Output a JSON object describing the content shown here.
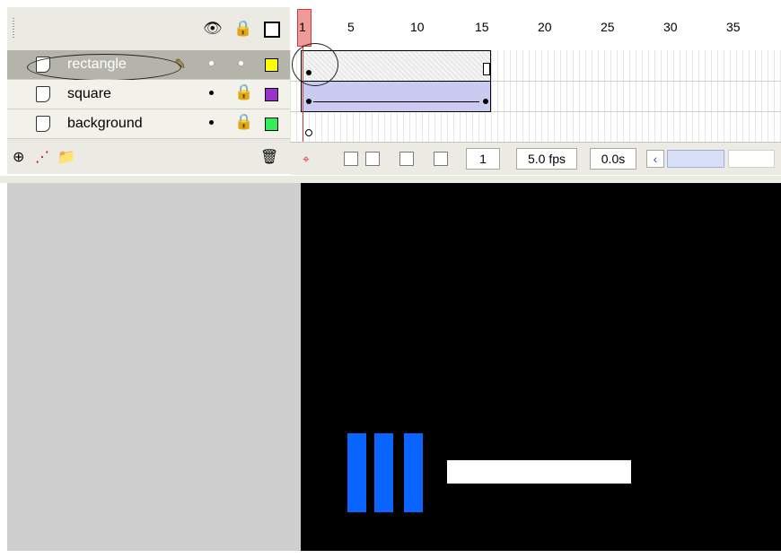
{
  "ruler": {
    "labels": [
      "1",
      "5",
      "10",
      "15",
      "20",
      "25",
      "30",
      "35"
    ]
  },
  "layers": [
    {
      "name": "rectangle",
      "selected": true,
      "color": "#ffff00"
    },
    {
      "name": "square",
      "selected": false,
      "color": "#9933cc"
    },
    {
      "name": "background",
      "selected": false,
      "color": "#33ee55"
    }
  ],
  "footer": {
    "frame": "1",
    "fps": "5.0 fps",
    "time": "0.0s"
  },
  "icons": {
    "eye": "eye-icon",
    "lock": "lock-icon",
    "outline": "outline-icon",
    "trash": "trash-icon",
    "pencil": "pencil-icon"
  },
  "stage": {
    "background": "#000000",
    "shapes_color": "#0a64ff",
    "rect_color": "#ffffff"
  }
}
